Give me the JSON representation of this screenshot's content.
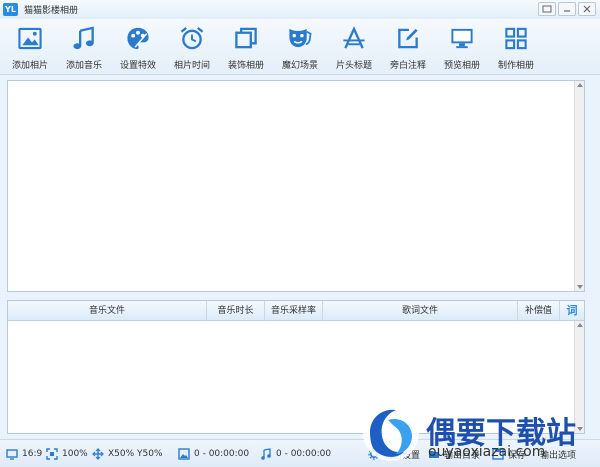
{
  "window": {
    "logo": "YL",
    "title": "猫猫影楼相册"
  },
  "toolbar": {
    "items": [
      {
        "label": "添加相片",
        "icon": "add-photo-icon"
      },
      {
        "label": "添加音乐",
        "icon": "music-note-icon"
      },
      {
        "label": "设置特效",
        "icon": "palette-icon"
      },
      {
        "label": "相片时间",
        "icon": "alarm-clock-icon"
      },
      {
        "label": "装饰相册",
        "icon": "frame-icon"
      },
      {
        "label": "魔幻场景",
        "icon": "mask-icon"
      },
      {
        "label": "片头标题",
        "icon": "title-icon"
      },
      {
        "label": "旁白注释",
        "icon": "edit-note-icon"
      },
      {
        "label": "预览相册",
        "icon": "monitor-icon"
      },
      {
        "label": "制作相册",
        "icon": "grid-icon"
      }
    ]
  },
  "music_table": {
    "columns": [
      "音乐文件",
      "音乐时长",
      "音乐采样率",
      "歌词文件",
      "补偿值"
    ],
    "lyric_button": "词"
  },
  "status": {
    "aspect": "16:9",
    "zoom": "100%",
    "position": "X50% Y50%",
    "photo_time": "0 - 00:00:00",
    "music_time": "0 - 00:00:00",
    "album_settings": "相册设置",
    "output_dir": "输出目录",
    "save": "保存",
    "output_options": "输出选项"
  },
  "watermark": {
    "brand": "偶要下载站",
    "domain": "ouyaoxiazai.com"
  },
  "colors": {
    "accent": "#2a8be6",
    "icon": "#2a7bd0",
    "panel_border": "#b7cadb"
  }
}
